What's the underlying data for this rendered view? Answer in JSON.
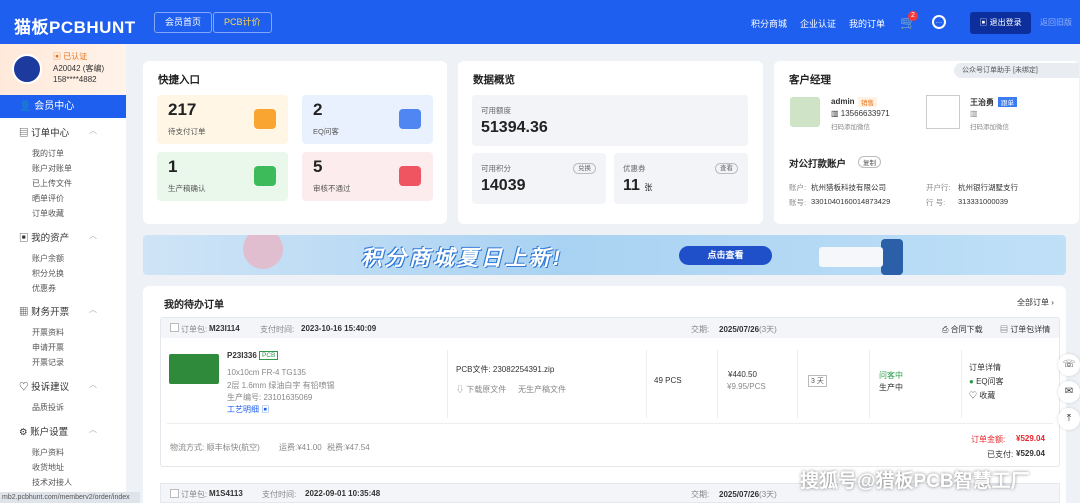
{
  "header": {
    "logo": "猫板PCBHUNT",
    "nav_home": "会员首页",
    "nav_pcb": "PCB计价",
    "points_mall": "积分商城",
    "enterprise": "企业认证",
    "my_orders": "我的订单",
    "cart_badge": "2",
    "logout": "退出登录",
    "old_version": "返回旧版"
  },
  "user": {
    "verified": "已认证",
    "name": "A20042 (客编)",
    "phone": "158****4882"
  },
  "sidebar": {
    "member_center": "会员中心",
    "groups": [
      {
        "title": "订单中心",
        "items": [
          "我的订单",
          "账户对账单",
          "已上传文件",
          "晒单评价",
          "订单收藏"
        ]
      },
      {
        "title": "我的资产",
        "items": [
          "账户余额",
          "积分兑换",
          "优惠券"
        ]
      },
      {
        "title": "财务开票",
        "items": [
          "开票资料",
          "申请开票",
          "开票记录"
        ]
      },
      {
        "title": "投诉建议",
        "items": [
          "品质投诉"
        ]
      },
      {
        "title": "账户设置",
        "items": [
          "账户资料",
          "收货地址",
          "技术对接人"
        ]
      }
    ]
  },
  "quick": {
    "title": "快捷入口",
    "boxes": [
      {
        "num": "217",
        "label": "待支付订单"
      },
      {
        "num": "2",
        "label": "EQ问客"
      },
      {
        "num": "1",
        "label": "生产稿确认"
      },
      {
        "num": "5",
        "label": "审核不通过"
      }
    ]
  },
  "overview": {
    "title": "数据概览",
    "credit_label": "可用额度",
    "credit": "51394.36",
    "points_label": "可用积分",
    "points": "14039",
    "exchange": "兑换",
    "coupon_label": "优惠券",
    "coupon": "11",
    "coupon_unit": "张",
    "view": "查看"
  },
  "manager": {
    "title": "客户经理",
    "wechat_tag": "公众号订单助手 [未绑定]",
    "name1": "admin",
    "tag1": "销售",
    "phone1": "13566633971",
    "add1": "扫码添加微信",
    "name2": "王治勇",
    "tag2": "跟单",
    "add2": "扫码添加微信",
    "acct_title": "对公打款账户",
    "copy": "复制",
    "acct_name_label": "账户:",
    "acct_name": "杭州猎板科技有限公司",
    "bank_label": "开户行:",
    "bank": "杭州银行湖墅支行",
    "acct_no_label": "账号:",
    "acct_no": "3301040160014873429",
    "row_label": "行 号:",
    "row_no": "313331000039"
  },
  "banner": {
    "text": "积分商城夏日上新!",
    "button": "点击查看"
  },
  "pending": {
    "title": "我的待办订单",
    "all": "全部订单",
    "order": {
      "pkg_label": "订单包:",
      "pkg": "M23I114",
      "paytime_label": "支付时间:",
      "paytime": "2023-10-16 15:40:09",
      "delivery_label": "交期:",
      "delivery": "2025/07/26",
      "delivery_days": "(3天)",
      "contract": "合同下载",
      "detail": "订单包详情",
      "item": "P23I336",
      "item_tag": "PCB",
      "spec1": "10x10cm FR-4 TG135",
      "spec2": "2层 1.6mm 绿油白字 有铅喷锡",
      "prod_no": "生产编号: 23101635069",
      "craft": "工艺明细",
      "pcb_file": "PCB文件: 23082254391.zip",
      "dl_file": "下载原文件",
      "no_prod": "无生产稿文件",
      "qty": "49 PCS",
      "price": "¥440.50",
      "unit_price": "¥9.95/PCS",
      "days": "3",
      "status1": "问客中",
      "status2": "生产中",
      "op1": "订单详情",
      "op2": "EQ问客",
      "op3": "收藏",
      "ship": "物流方式: 顺丰标快(航空)",
      "freight": "运费:¥41.00",
      "tax": "税费:¥47.54",
      "total_label": "订单金额:",
      "total": "¥529.04",
      "paid_label": "已支付:",
      "paid": "¥529.04"
    },
    "order2": {
      "pkg": "M1S4113",
      "paytime": "2022-09-01 10:35:48",
      "delivery": "2025/07/26",
      "delivery_days": "(3天)"
    }
  },
  "url": "mb2.pcbhunt.com/memberv2/order/index",
  "watermark": "搜狐号@猎板PCB智慧工厂",
  "colors": {
    "primary": "#1f5ff0",
    "red": "#e8262c"
  }
}
